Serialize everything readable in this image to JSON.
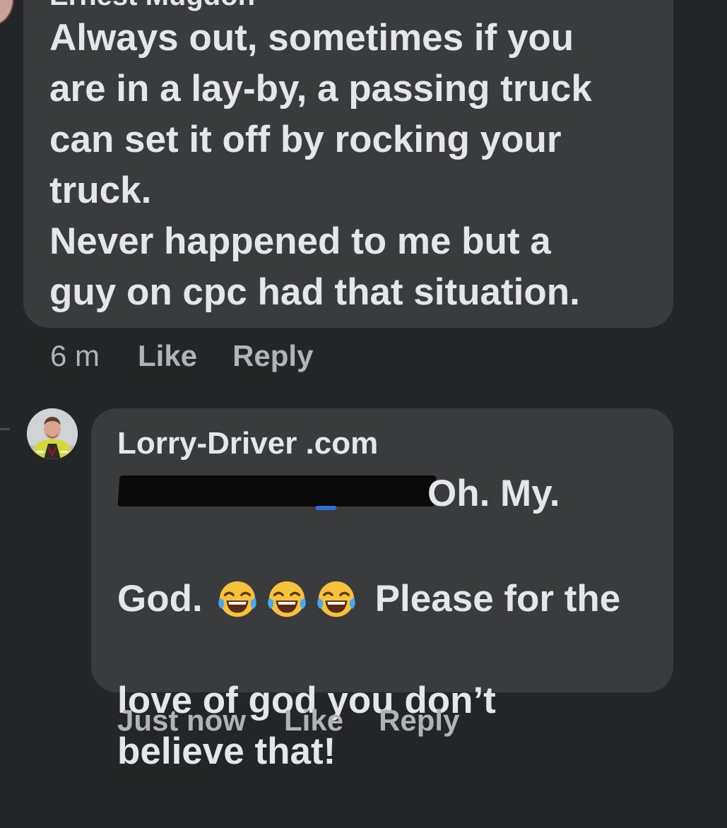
{
  "comment_1": {
    "author_partial": "Ernest Mugdon",
    "text": "Always out, sometimes if you\nare in a lay-by, a passing truck\ncan set it off by rocking your\ntruck.\nNever happened to me but a\nguy on cpc had that situation.",
    "time": "6 m",
    "like_label": "Like",
    "reply_label": "Reply"
  },
  "comment_2": {
    "author": "Lorry-Driver .com",
    "text_line_1": "Oh. My.",
    "text_line_2_start": "God.",
    "emojis": [
      "face-with-tears-of-joy-icon",
      "face-with-tears-of-joy-icon",
      "face-with-tears-of-joy-icon"
    ],
    "text_line_2_end": "Please for the",
    "text_rest": "love of god you don’t\nbelieve that!",
    "time": "Just now",
    "like_label": "Like",
    "reply_label": "Reply"
  },
  "colors": {
    "background": "#242526",
    "bubble": "#3a3b3c",
    "primary_text": "#e4e6eb",
    "secondary_text": "#b0b3b8"
  }
}
